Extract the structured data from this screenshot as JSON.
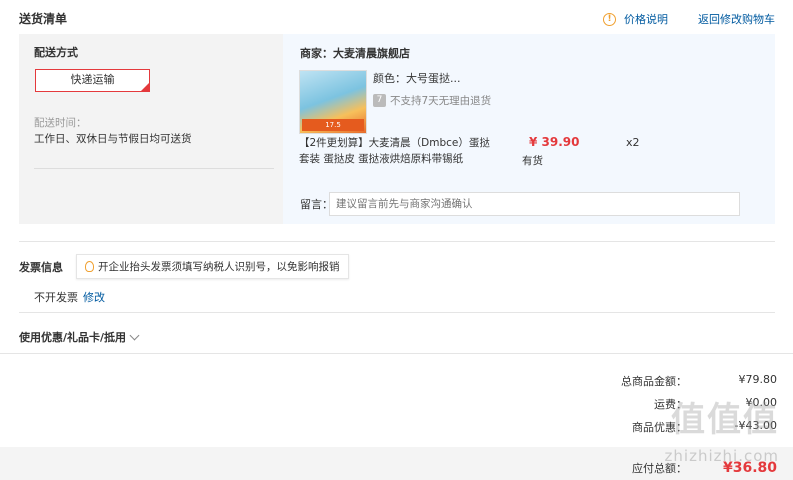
{
  "header": {
    "title": "送货清单",
    "price_info": "价格说明",
    "back_to_cart": "返回修改购物车"
  },
  "shipping": {
    "method_label": "配送方式",
    "method_value": "快递运输",
    "time_label": "配送时间：",
    "time_value": "工作日、双休日与节假日均可送货"
  },
  "order": {
    "merchant": "商家：大麦清晨旗舰店",
    "image_badge": "17.5",
    "color": "颜色：大号蛋挞...",
    "no_refund": "不支持7天无理由退货",
    "no_refund_icon": "7",
    "product_name": "【2件更划算】大麦清晨（Dmbce）蛋挞套装 蛋挞皮 蛋挞液烘焙原料带锡纸",
    "price": "¥ 39.90",
    "stock": "有货",
    "quantity": "x2",
    "message_label": "留言：",
    "message_placeholder": "建议留言前先与商家沟通确认"
  },
  "invoice": {
    "label": "发票信息",
    "tip": "开企业抬头发票须填写纳税人识别号，以免影响报销",
    "status": "不开发票",
    "edit": "修改"
  },
  "coupon": {
    "label": "使用优惠/礼品卡/抵用"
  },
  "summary": {
    "goods_total_label": "总商品金额：",
    "goods_total_value": "¥79.80",
    "shipping_label": "运费：",
    "shipping_value": "¥0.00",
    "discount_label": "商品优惠：",
    "discount_value": "-¥43.00",
    "payable_label": "应付总额：",
    "payable_value": "¥36.80"
  },
  "watermark": {
    "logo": "值值值",
    "site": "zhizhizhi.com"
  },
  "colors": {
    "accent_red": "#e4393c",
    "link_blue": "#005aa0",
    "warn_orange": "#f0a030"
  }
}
